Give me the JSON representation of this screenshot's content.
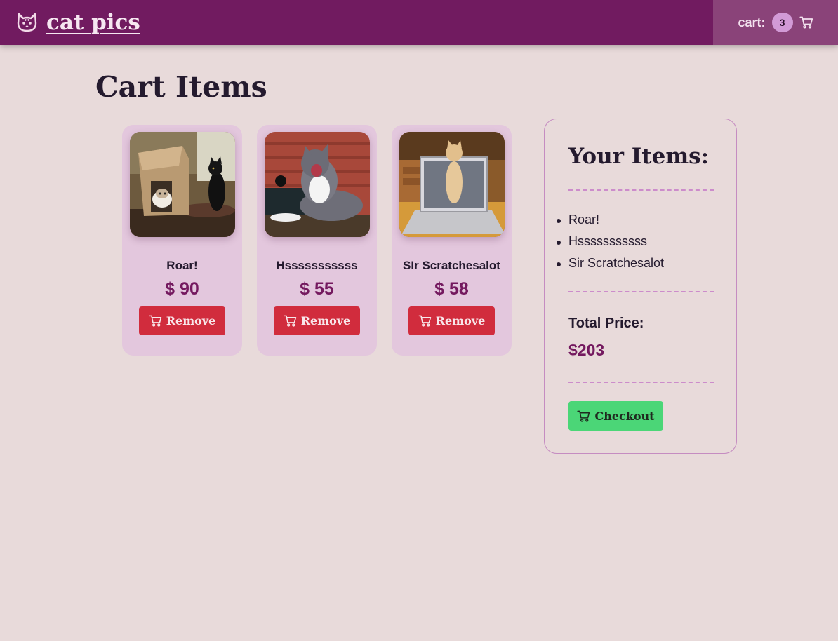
{
  "header": {
    "brand_name": "cat pics",
    "cart_label": "cart:",
    "cart_count": "3"
  },
  "page": {
    "title": "Cart Items"
  },
  "items": [
    {
      "name": "Roar!",
      "price": "$ 90",
      "remove_label": "Remove"
    },
    {
      "name": "Hsssssssssss",
      "price": "$ 55",
      "remove_label": "Remove"
    },
    {
      "name": "SIr Scratchesalot",
      "price": "$ 58",
      "remove_label": "Remove"
    }
  ],
  "summary": {
    "title": "Your Items:",
    "list": [
      "Roar!",
      "Hsssssssssss",
      "Sir Scratchesalot"
    ],
    "total_label": "Total Price:",
    "total_value": "$203",
    "checkout_label": "Checkout"
  },
  "colors": {
    "header_bg": "#711b60",
    "page_bg": "#e8dada",
    "card_bg": "#e3c7dd",
    "price_accent": "#74195f",
    "remove_button": "#d12c3d",
    "checkout_button": "#4bd677"
  },
  "icons": {
    "brand": "cat-face-icon",
    "cart": "shopping-cart-icon"
  }
}
